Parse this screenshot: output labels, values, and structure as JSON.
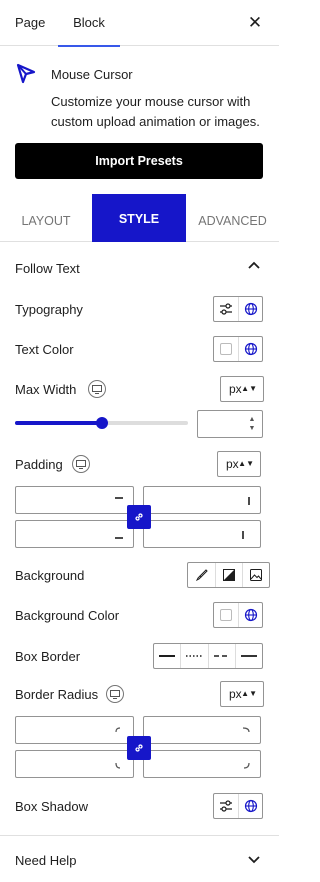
{
  "header": {
    "tabs": [
      {
        "label": "Page",
        "active": false
      },
      {
        "label": "Block",
        "active": true
      }
    ],
    "close_icon": "close-icon"
  },
  "block": {
    "title": "Mouse Cursor",
    "description": "Customize your mouse cursor with custom upload animation or images.",
    "icon": "cursor-arrow-icon",
    "import_label": "Import Presets"
  },
  "mode_tabs": [
    {
      "label": "LAYOUT",
      "active": false
    },
    {
      "label": "STYLE",
      "active": true
    },
    {
      "label": "ADVANCED",
      "active": false
    }
  ],
  "panel": {
    "title": "Follow Text",
    "expanded": true,
    "typography_label": "Typography",
    "text_color_label": "Text Color",
    "max_width_label": "Max Width",
    "max_width_unit": "px",
    "max_width_value": "",
    "max_width_slider_fraction": 0.5,
    "padding_label": "Padding",
    "padding_unit": "px",
    "background_label": "Background",
    "background_color_label": "Background Color",
    "box_border_label": "Box Border",
    "border_radius_label": "Border Radius",
    "border_radius_unit": "px",
    "box_shadow_label": "Box Shadow"
  },
  "footer": {
    "need_help_label": "Need Help"
  },
  "colors": {
    "accent": "#1616c9",
    "tab_underline": "#3858e9",
    "button_black": "#000000"
  }
}
